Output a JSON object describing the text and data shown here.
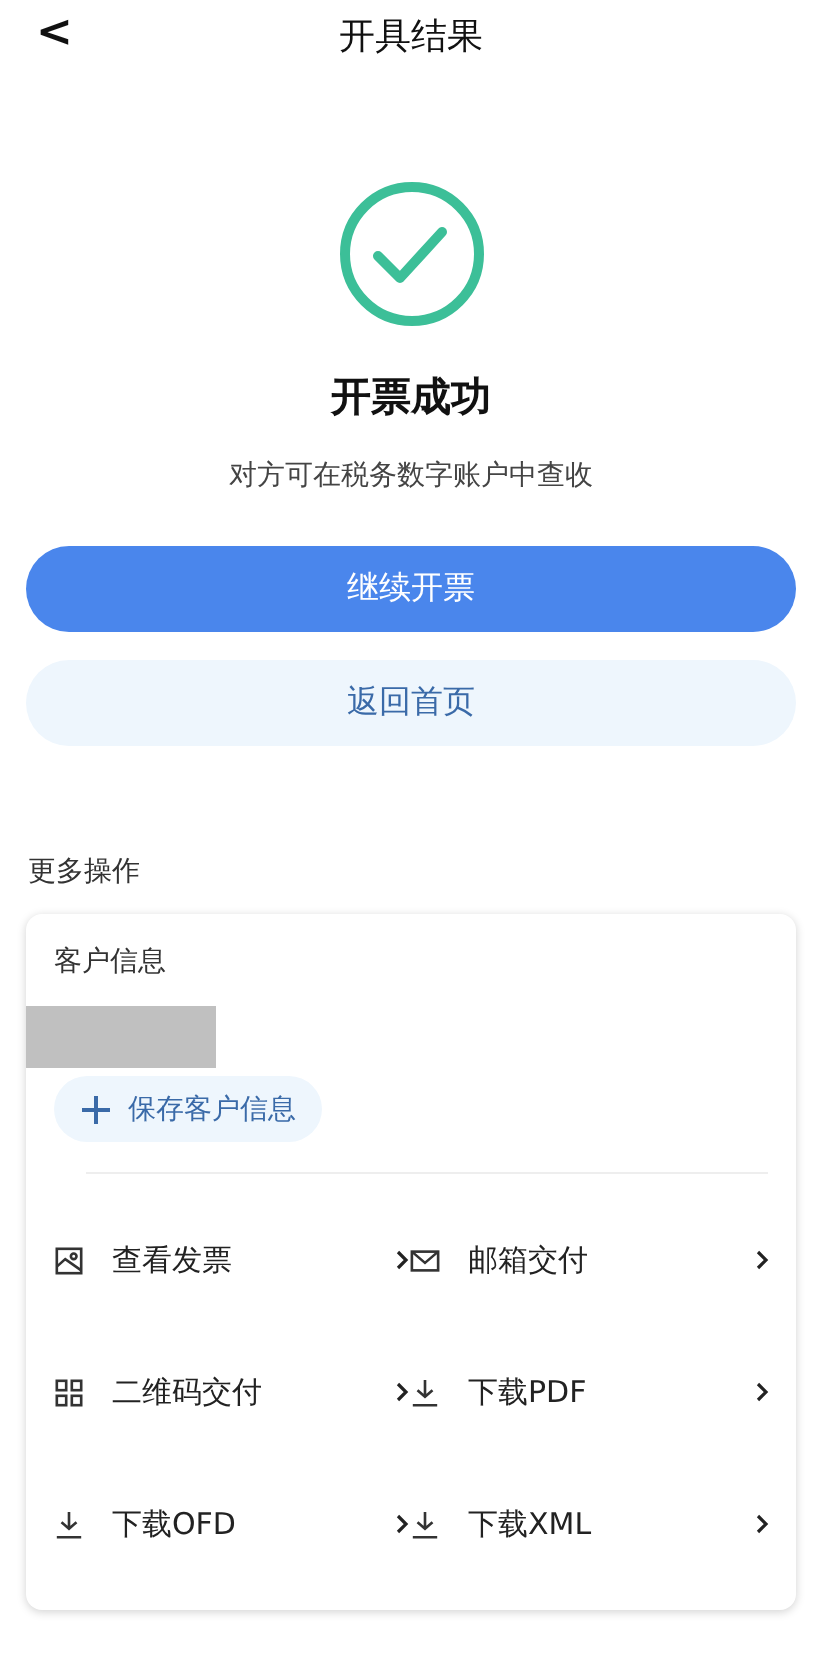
{
  "header": {
    "back": "<",
    "title": "开具结果"
  },
  "result": {
    "title": "开票成功",
    "subtitle": "对方可在税务数字账户中查收"
  },
  "buttons": [
    {
      "label": "继续开票",
      "kind": "primary"
    },
    {
      "label": "返回首页",
      "kind": "secondary"
    }
  ],
  "more": {
    "title": "更多操作",
    "customer": {
      "title": "客户信息",
      "save": "保存客户信息"
    },
    "actions": [
      {
        "label": "查看发票",
        "kind": "image"
      },
      {
        "label": "邮箱交付",
        "kind": "mail"
      },
      {
        "label": "二维码交付",
        "kind": "qr"
      },
      {
        "label": "下载PDF",
        "kind": "download"
      },
      {
        "label": "下载OFD",
        "kind": "download"
      },
      {
        "label": "下载XML",
        "kind": "download"
      }
    ]
  }
}
